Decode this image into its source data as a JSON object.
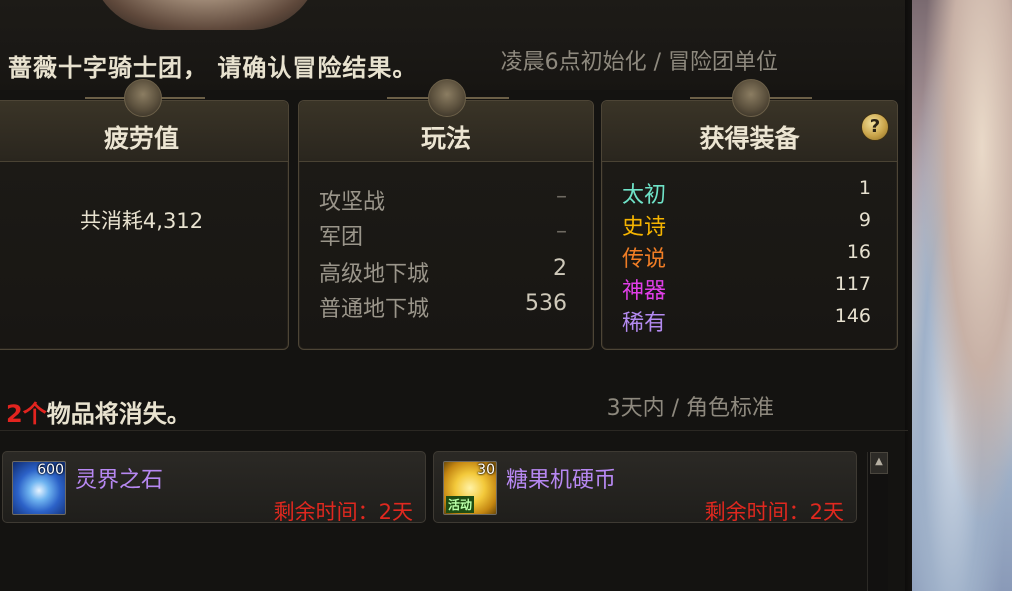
{
  "header": {
    "title": "蔷薇十字骑士团， 请确认冒险结果。",
    "note": "凌晨6点初始化 / 冒险团单位"
  },
  "fatigue": {
    "title": "疲劳值",
    "text": "共消耗4,312"
  },
  "modes": {
    "title": "玩法",
    "rows": [
      {
        "label": "攻坚战",
        "value": "–"
      },
      {
        "label": "军团",
        "value": "–"
      },
      {
        "label": "高级地下城",
        "value": "2"
      },
      {
        "label": "普通地下城",
        "value": "536"
      }
    ]
  },
  "equipment": {
    "title": "获得装备",
    "help": "?",
    "rows": [
      {
        "label": "太初",
        "value": "1",
        "color": "#6fe3c8"
      },
      {
        "label": "史诗",
        "value": "9",
        "color": "#f5b400"
      },
      {
        "label": "传说",
        "value": "16",
        "color": "#f07d25"
      },
      {
        "label": "神器",
        "value": "117",
        "color": "#e03ee8"
      },
      {
        "label": "稀有",
        "value": "146",
        "color": "#b38af0"
      }
    ]
  },
  "expiring": {
    "count": "2个",
    "title": "物品将消失。",
    "note": "3天内 / 角色标准",
    "items": [
      {
        "name": "灵界之石",
        "count": "600",
        "remain": "剩余时间：2天",
        "icon": "spirit-stone-icon",
        "tag": ""
      },
      {
        "name": "糖果机硬币",
        "count": "30",
        "remain": "剩余时间：2天",
        "icon": "candy-coin-icon",
        "tag": "活动"
      }
    ]
  },
  "scroll": {
    "up": "▲"
  }
}
